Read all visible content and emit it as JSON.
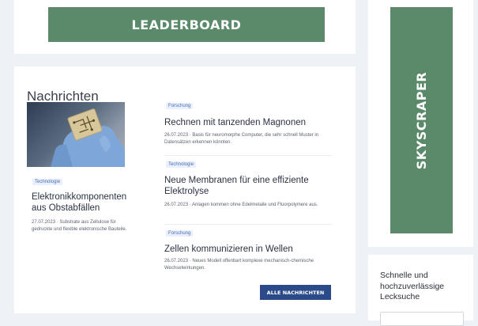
{
  "ads": {
    "leaderboard": "LEADERBOARD",
    "skyscraper": "SKYSCRAPER"
  },
  "news": {
    "heading": "Nachrichten",
    "featured": {
      "tag": "Technologie",
      "title": "Elektronikkomponenten aus Obstabfällen",
      "meta": "27.07.2023 · Substrate aus Zellulose für gedruckte und flexible elektronische Bauteile."
    },
    "articles": [
      {
        "tag": "Forschung",
        "title": "Rechnen mit tanzenden Magnonen",
        "meta": "26.07.2023 · Basis für neuromorphe Computer, die sehr schnell Muster in Datensätzen erkennen könnten."
      },
      {
        "tag": "Technologie",
        "title": "Neue Membranen für eine effiziente Elektrolyse",
        "meta": "26.07.2023 · Anlagen kommen ohne Edelmetalle und Fluorpolymere aus."
      },
      {
        "tag": "Forschung",
        "title": "Zellen kommunizieren in Wellen",
        "meta": "26.07.2023 · Neues Modell offenbart komplexe mechanisch-chemische Wechselwirkungen."
      }
    ],
    "all_button": "ALLE NACHRICHTEN"
  },
  "sidebar": {
    "promo_text": "Schnelle und hochzuverlässige Lecksuche"
  },
  "colors": {
    "ad_background": "#5a8a6a",
    "button_primary": "#2b4a8a",
    "tag_text": "#4a6fb5"
  }
}
